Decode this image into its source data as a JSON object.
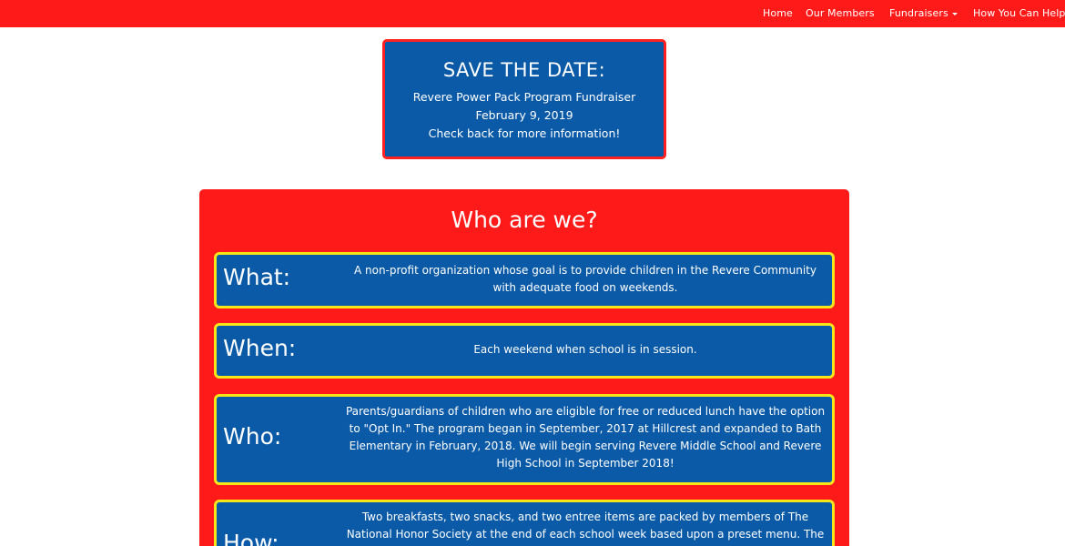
{
  "nav": {
    "items": [
      {
        "label": "Home"
      },
      {
        "label": "Our Members"
      },
      {
        "label": "Fundraisers",
        "dropdown": true
      },
      {
        "label": "How You Can Help"
      }
    ]
  },
  "announcement": {
    "title": "SAVE THE DATE:",
    "line1": "Revere Power Pack Program Fundraiser",
    "line2": "February 9, 2019",
    "line3": "Check back for more information!"
  },
  "about": {
    "title": "Who are we?",
    "cards": [
      {
        "label": "What:",
        "text": "A non-profit organization whose goal is to provide children in the Revere Community with adequate food on weekends."
      },
      {
        "label": "When:",
        "text": "Each weekend when school is in session."
      },
      {
        "label": "Who:",
        "text": "Parents/guardians of children who are eligible for free or reduced lunch have the option to \"Opt In.\" The program began in September, 2017 at Hillcrest and expanded to Bath Elementary in February, 2018. We will begin serving Revere Middle School and Revere High School in September 2018!"
      },
      {
        "label": "How:",
        "text": "Two breakfasts, two snacks, and two entree items are packed by members of The National Honor Society at the end of each school week based upon a preset menu. The"
      }
    ]
  },
  "colors": {
    "brand_red": "#ff1a1a",
    "card_blue": "#0a5aa8",
    "card_border": "#f5e61a",
    "text": "#ffffff"
  }
}
